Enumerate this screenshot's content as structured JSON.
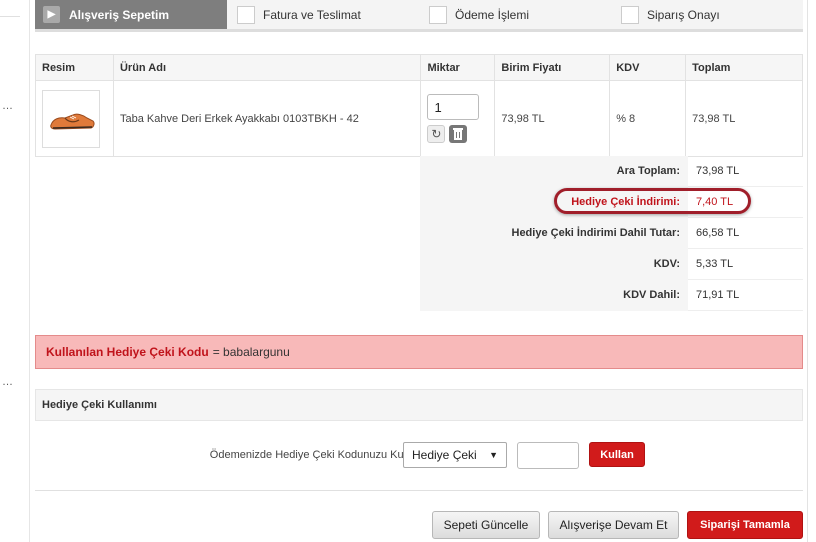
{
  "steps": [
    {
      "label": "Alışveriş Sepetim",
      "active": true,
      "icon": "chevron-right-icon"
    },
    {
      "label": "Fatura ve Teslimat",
      "active": false
    },
    {
      "label": "Ödeme İşlemi",
      "active": false
    },
    {
      "label": "Siparış Onayı",
      "active": false
    }
  ],
  "cart": {
    "headers": {
      "image": "Resim",
      "product": "Ürün Adı",
      "quantity": "Miktar",
      "unit_price": "Birim Fiyatı",
      "vat": "KDV",
      "total": "Toplam"
    },
    "items": [
      {
        "product": "Taba Kahve Deri Erkek Ayakkabı 0103TBKH - 42",
        "quantity": "1",
        "unit_price": "73,98 TL",
        "vat": "% 8",
        "total": "73,98 TL"
      }
    ]
  },
  "summary": [
    {
      "label": "Ara Toplam:",
      "value": "73,98 TL"
    },
    {
      "label": "Hediye Çeki İndirimi:",
      "value": "7,40 TL"
    },
    {
      "label": "Hediye Çeki İndirimi Dahil Tutar:",
      "value": "66,58 TL"
    },
    {
      "label": "KDV:",
      "value": "5,33 TL"
    },
    {
      "label": "KDV Dahil:",
      "value": "71,91 TL"
    }
  ],
  "alert": {
    "keyword": "Kullanılan Hediye Çeki Kodu",
    "rest": "= babalargunu"
  },
  "gift": {
    "title": "Hediye Çeki Kullanımı",
    "label": "Ödemenizde Hediye Çeki Kodunuzu Kullanın:",
    "select_value": "Hediye Çeki",
    "apply_label": "Kullan"
  },
  "actions": {
    "update": "Sepeti Güncelle",
    "continue": "Alışverişe Devam Et",
    "complete": "Siparişi Tamamla"
  },
  "colors": {
    "accent_red": "#d11b1b",
    "discount_red": "#c0131b",
    "alert_bg": "#f8b9b9",
    "active_step": "#7e7e7e"
  }
}
